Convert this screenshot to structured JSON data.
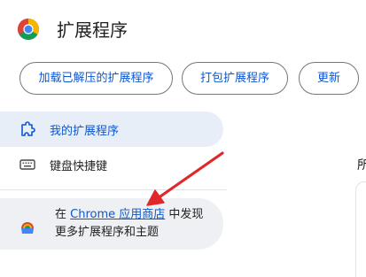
{
  "header": {
    "title": "扩展程序"
  },
  "toolbar": {
    "load_unpacked": "加载已解压的扩展程序",
    "pack": "打包扩展程序",
    "update": "更新"
  },
  "sidebar": {
    "items": [
      {
        "label": "我的扩展程序",
        "icon": "puzzle-piece-icon",
        "active": true
      },
      {
        "label": "键盘快捷键",
        "icon": "keyboard-icon",
        "active": false
      }
    ],
    "promo": {
      "prefix": "在 ",
      "link": "Chrome 应用商店",
      "suffix": " 中发现更多扩展程序和主题",
      "icon": "chrome-web-store-icon"
    }
  },
  "main": {
    "cut_text": "所"
  },
  "colors": {
    "accent": "#0b57d0",
    "active_bg": "#e8eef7",
    "promo_bg": "#eef0f3",
    "annotation_arrow": "#e0282a"
  }
}
